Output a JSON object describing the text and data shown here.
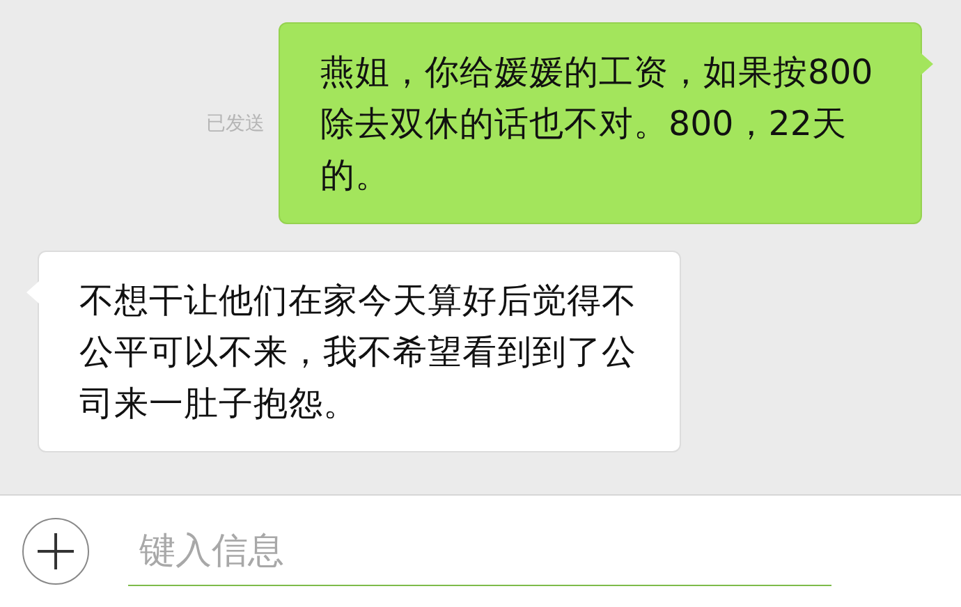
{
  "messages": [
    {
      "kind": "sent",
      "status": "已发送",
      "text": "燕姐，你给媛媛的工资，如果按800除去双休的话也不对。800，22天的。"
    },
    {
      "kind": "received",
      "text": "不想干让他们在家今天算好后觉得不公平可以不来，我不希望看到到了公司来一肚子抱怨。"
    }
  ],
  "composer": {
    "placeholder": "键入信息"
  }
}
